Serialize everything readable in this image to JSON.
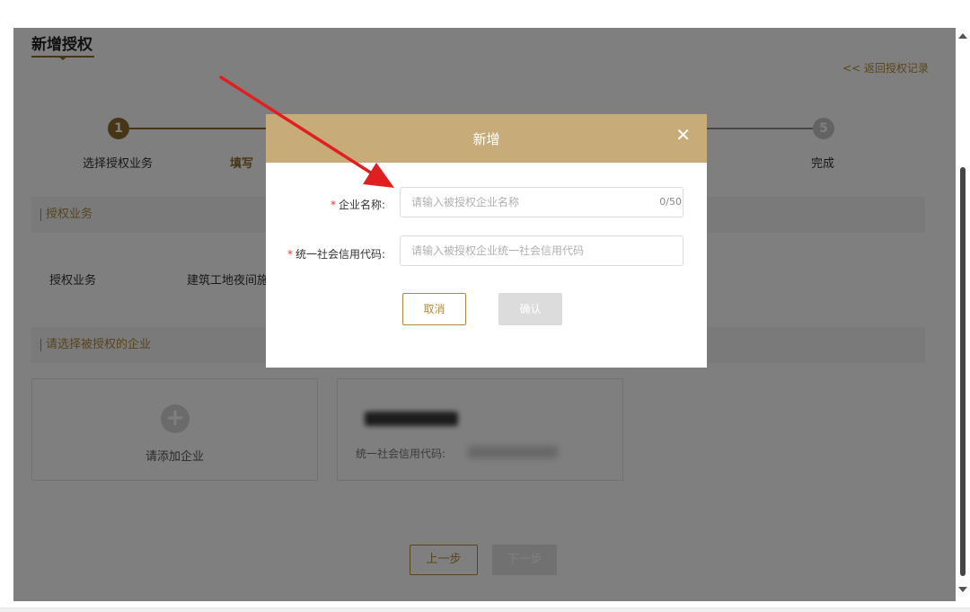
{
  "page": {
    "title": "新增授权",
    "back_link": "<< 返回授权记录"
  },
  "steps": [
    {
      "number": "1",
      "label": "选择授权业务",
      "state": "active"
    },
    {
      "number": "",
      "label": "填写",
      "state": "active"
    },
    {
      "number": "5",
      "label": "完成",
      "state": "pending"
    }
  ],
  "sections": {
    "business": "授权业务",
    "select_company": "请选择被授权的企业"
  },
  "business": {
    "label": "授权业务",
    "value": "建筑工地夜间施"
  },
  "cards": {
    "add_label": "请添加企业",
    "credit_code_label": "统一社会信用代码:"
  },
  "nav": {
    "prev_label": "上一步",
    "next_label": "下一步"
  },
  "modal": {
    "title": "新增",
    "close_icon": "close-icon",
    "company_name": {
      "label": "企业名称:",
      "placeholder": "请输入被授权企业名称",
      "value": "",
      "counter": "0/50"
    },
    "credit_code": {
      "label": "统一社会信用代码:",
      "placeholder": "请输入被授权企业统一社会信用代码",
      "value": ""
    },
    "cancel_label": "取消",
    "confirm_label": "确认"
  },
  "colors": {
    "accent": "#b08a3a",
    "header": "#c7ac7a",
    "required": "#e33333",
    "annotation_arrow": "#e02020"
  }
}
